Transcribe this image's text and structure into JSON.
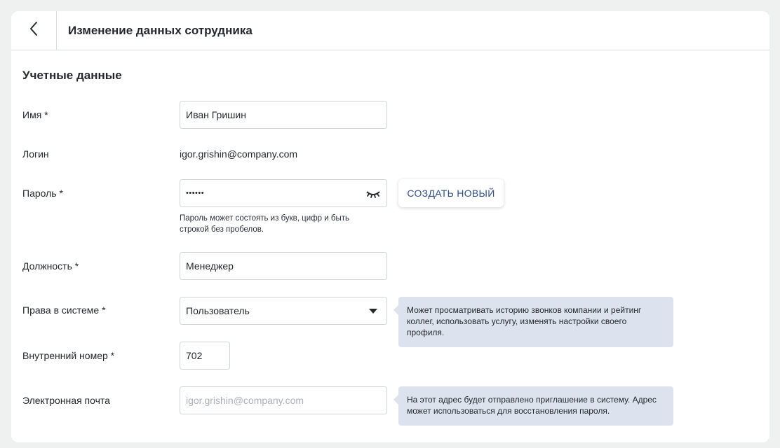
{
  "header": {
    "title": "Изменение данных сотрудника",
    "back_icon": "chevron-left-icon"
  },
  "section": {
    "title": "Учетные данные"
  },
  "fields": {
    "name": {
      "label": "Имя *",
      "value": "Иван Гришин"
    },
    "login": {
      "label": "Логин",
      "value": "igor.grishin@company.com"
    },
    "password": {
      "label": "Пароль *",
      "value": "••••••",
      "hint_line1": "Пароль может состоять из букв, цифр и быть",
      "hint_line2": "строкой без пробелов.",
      "eye_icon": "eye-closed-icon",
      "create_new_label": "СОЗДАТЬ НОВЫЙ"
    },
    "position": {
      "label": "Должность *",
      "value": "Менеджер"
    },
    "rights": {
      "label": "Права в системе *",
      "value": "Пользователь",
      "tooltip": "Может просматривать историю звонков компании и рейтинг коллег, использовать услугу, изменять настройки своего профиля."
    },
    "extension": {
      "label": "Внутренний номер *",
      "value": "702"
    },
    "email": {
      "label": "Электронная почта",
      "placeholder": "igor.grishin@company.com",
      "tooltip": "На этот адрес будет отправлено приглашение в систему. Адрес может использоваться для восстановления пароля."
    }
  },
  "colors": {
    "background": "#eff1f1",
    "accent": "#2e4f8c",
    "tooltip_bg": "#dde3ee"
  }
}
